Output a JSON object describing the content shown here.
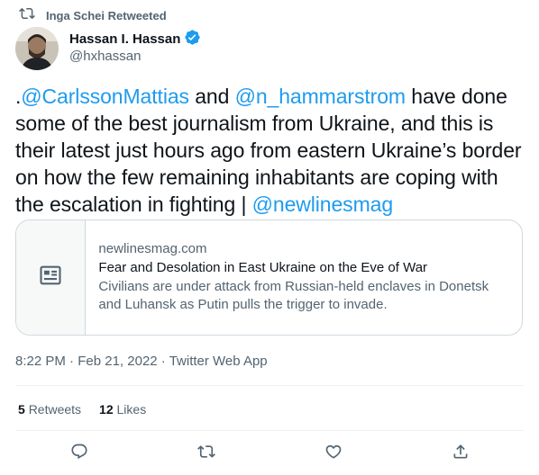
{
  "retweet_context": {
    "label": "Inga Schei Retweeted",
    "icon": "retweet-icon"
  },
  "author": {
    "name": "Hassan I. Hassan",
    "handle": "@hxhassan",
    "verified": true,
    "verified_color": "#1d9bf0",
    "avatar_icon": "profile-photo"
  },
  "tweet": {
    "segments": [
      {
        "type": "text",
        "text": "."
      },
      {
        "type": "mention",
        "text": "@CarlssonMattias"
      },
      {
        "type": "text",
        "text": " and "
      },
      {
        "type": "mention",
        "text": "@n_hammarstrom"
      },
      {
        "type": "text",
        "text": " have done some of the best journalism from Ukraine, and this is their latest just hours ago from eastern Ukraine’s border on how the few remaining inhabitants are coping with the escalation in fighting | "
      },
      {
        "type": "mention",
        "text": "@newlinesmag"
      }
    ]
  },
  "link_card": {
    "icon": "article-icon",
    "domain": "newlinesmag.com",
    "title": "Fear and Desolation in East Ukraine on the Eve of War",
    "description": "Civilians are under attack from Russian-held enclaves in Donetsk and Luhansk as Putin pulls the trigger to invade."
  },
  "meta": {
    "time": "8:22 PM",
    "date": "Feb 21, 2022",
    "source": "Twitter Web App",
    "separator": " · "
  },
  "stats": {
    "retweets_count": "5",
    "retweets_label": "Retweets",
    "likes_count": "12",
    "likes_label": "Likes"
  },
  "actions": [
    "reply-icon",
    "retweet-icon",
    "like-icon",
    "share-icon"
  ],
  "colors": {
    "link": "#1d9bf0",
    "muted": "#536471",
    "text": "#0f1419",
    "border": "#cfd9de"
  }
}
